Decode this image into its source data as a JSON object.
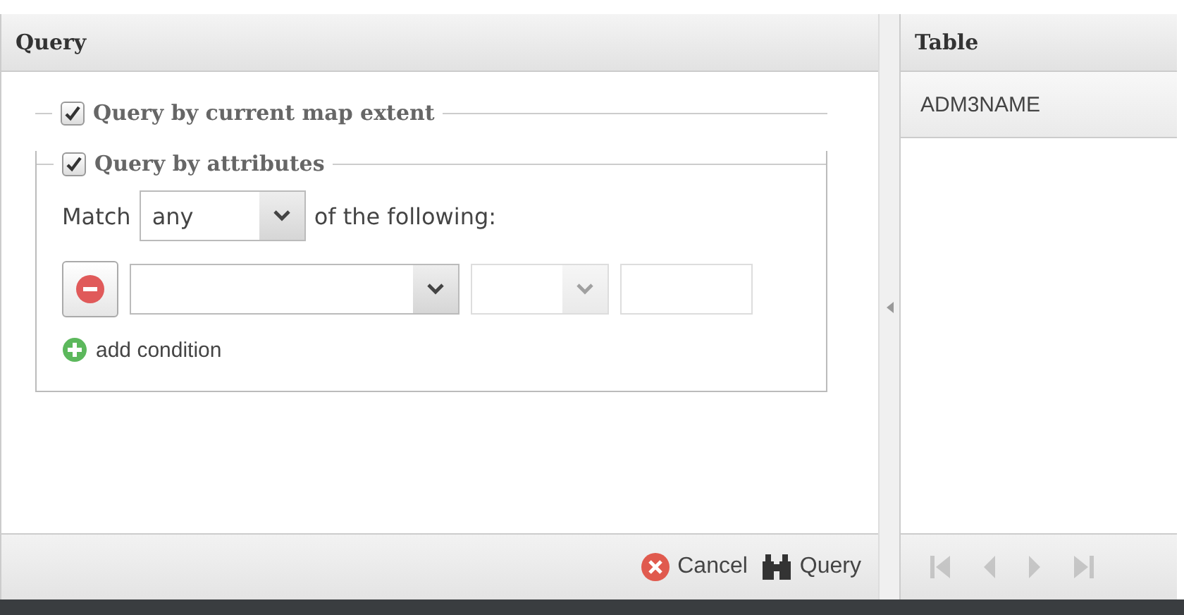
{
  "query_panel": {
    "title": "Query",
    "extent_group": {
      "label": "Query by current map extent",
      "checked": true
    },
    "attributes_group": {
      "label": "Query by attributes",
      "checked": true,
      "match": {
        "prefix": "Match",
        "value": "any",
        "suffix": "of the following:"
      },
      "conditions": [
        {
          "field": {
            "disabled": false
          },
          "operator": {
            "disabled": true
          },
          "value": {
            "disabled": true
          }
        }
      ],
      "add_condition": "add condition"
    },
    "buttons": [
      {
        "kind": "cancel",
        "label": "Cancel"
      },
      {
        "kind": "query",
        "label": "Query"
      }
    ]
  },
  "table_panel": {
    "title": "Table",
    "columns": [
      "ADM3NAME"
    ],
    "pager": [
      {
        "kind": "first",
        "disabled": true
      },
      {
        "kind": "prev",
        "disabled": true
      },
      {
        "kind": "next",
        "disabled": true
      },
      {
        "kind": "last",
        "disabled": true
      }
    ]
  }
}
